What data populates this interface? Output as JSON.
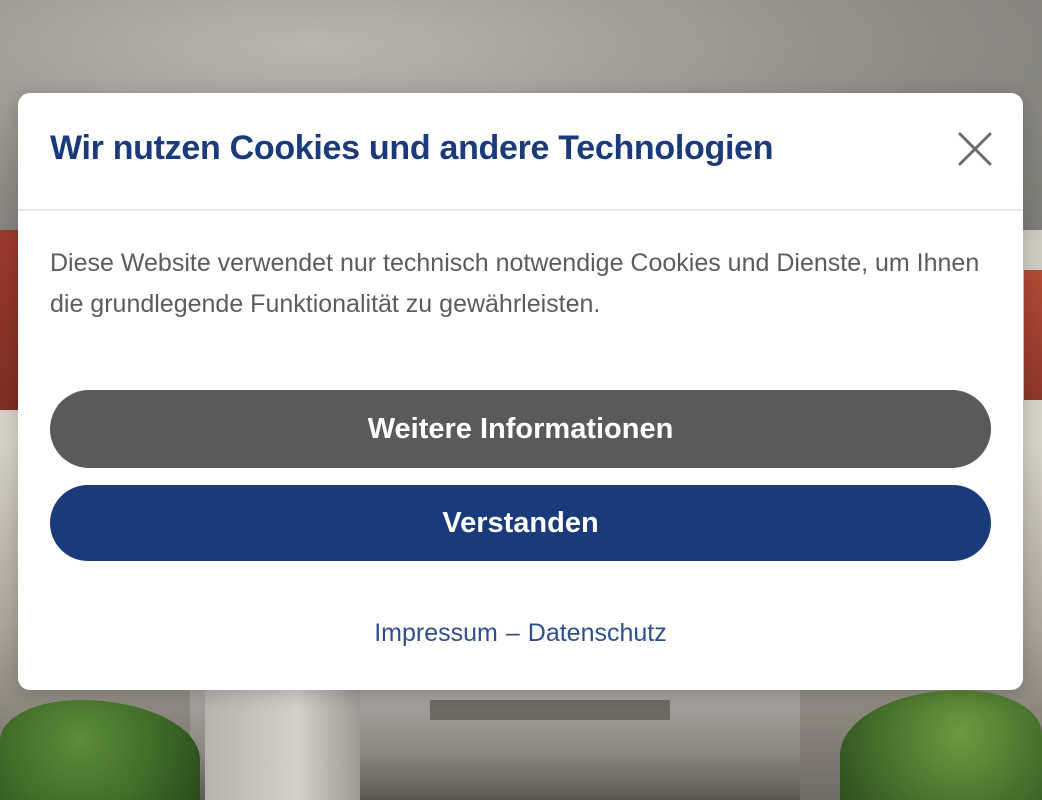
{
  "modal": {
    "title": "Wir nutzen Cookies und andere Technologien",
    "body": "Diese Website verwendet nur technisch notwendige Cookies und Dienste, um Ihnen die grundlegende Funktionalität zu gewährleisten.",
    "more_info_label": "Weitere Informationen",
    "accept_label": "Verstanden",
    "close_icon": "close-icon"
  },
  "footer": {
    "impressum_label": "Impressum",
    "separator": "–",
    "privacy_label": "Datenschutz"
  },
  "colors": {
    "title": "#1a3a7c",
    "primary_button": "#1a3a7c",
    "secondary_button": "#5a5a5a",
    "body_text": "#5c5c5c",
    "link": "#2f4e8c"
  }
}
